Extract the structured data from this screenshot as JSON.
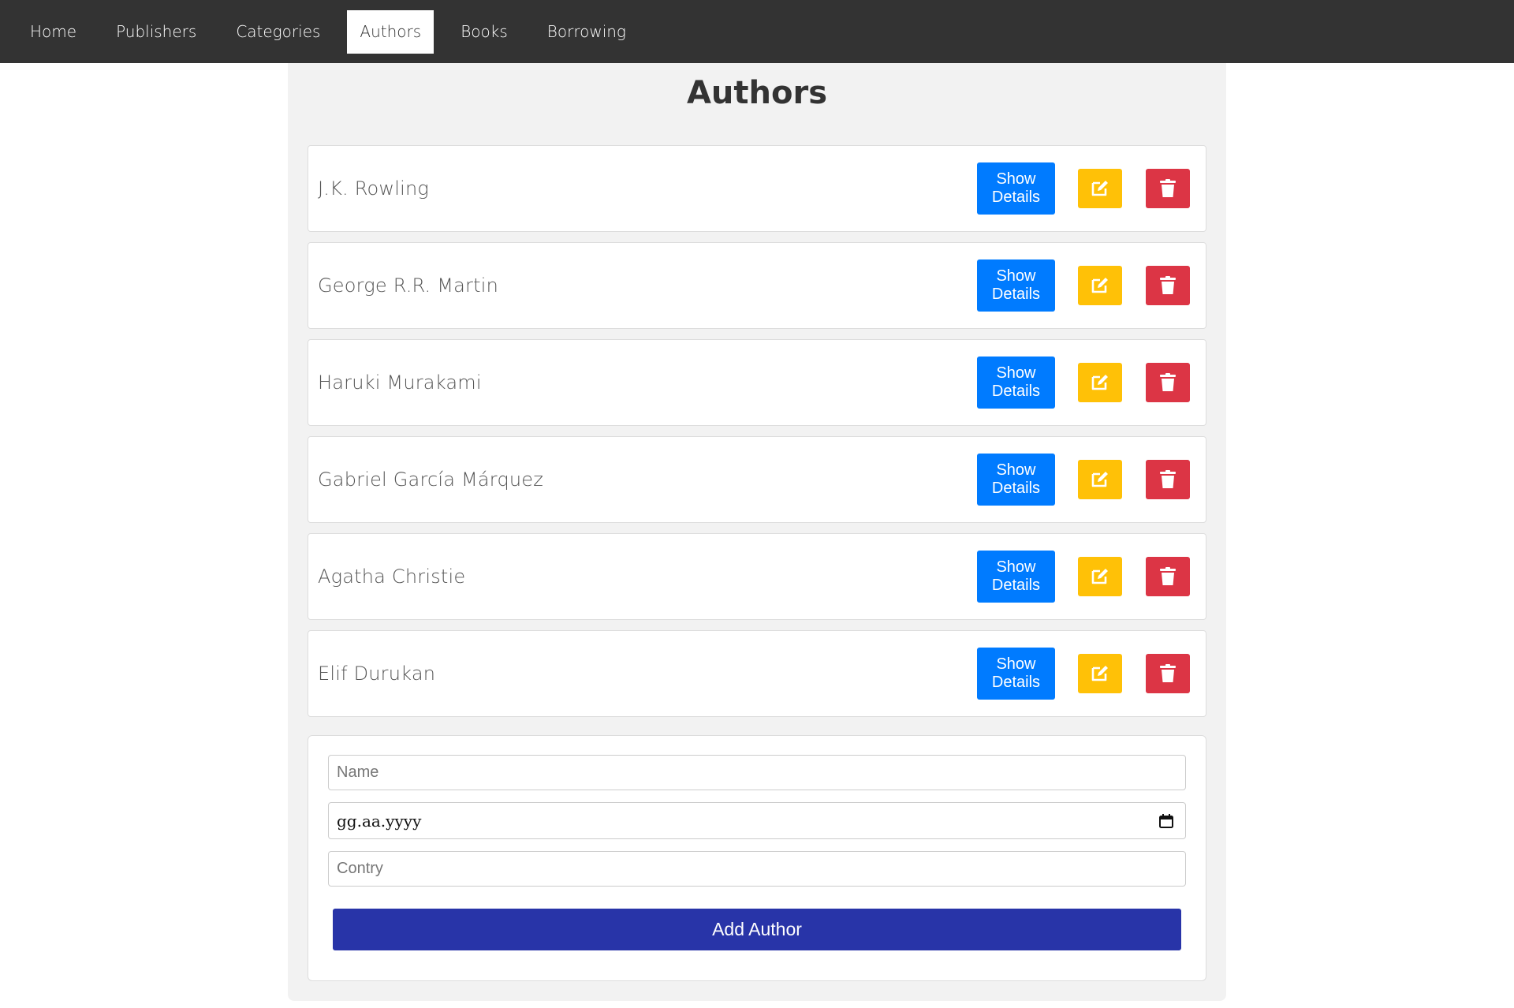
{
  "nav": {
    "items": [
      {
        "label": "Home"
      },
      {
        "label": "Publishers"
      },
      {
        "label": "Categories"
      },
      {
        "label": "Authors"
      },
      {
        "label": "Books"
      },
      {
        "label": "Borrowing"
      }
    ],
    "active": "Authors"
  },
  "page": {
    "title": "Authors"
  },
  "authors": [
    {
      "name": "J.K. Rowling"
    },
    {
      "name": "George R.R. Martin"
    },
    {
      "name": "Haruki Murakami"
    },
    {
      "name": "Gabriel García Márquez"
    },
    {
      "name": "Agatha Christie"
    },
    {
      "name": "Elif Durukan"
    }
  ],
  "actions": {
    "details_label": "Show\nDetails",
    "edit_icon": "edit-icon",
    "delete_icon": "trash-icon"
  },
  "form": {
    "name_placeholder": "Name",
    "date_value": "gg.aa.yyyy",
    "country_placeholder": "Contry",
    "submit_label": "Add Author"
  },
  "colors": {
    "navbar": "#333333",
    "details_button": "#007bff",
    "edit_button": "#ffc107",
    "delete_button": "#dc3545",
    "add_button": "#2834a8"
  }
}
